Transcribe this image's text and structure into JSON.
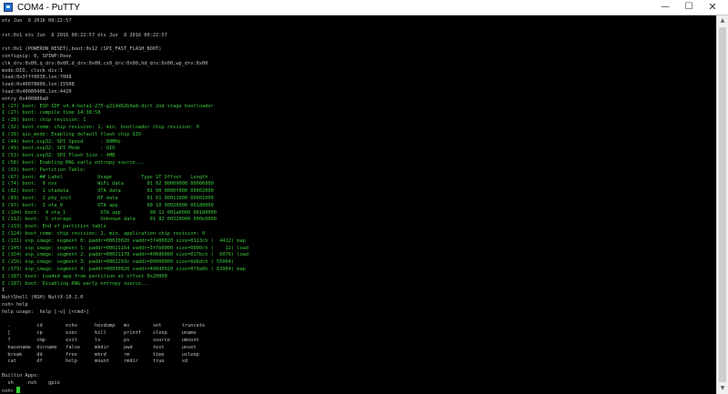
{
  "window": {
    "title": "COM4 - PuTTY",
    "icon": "putty-icon",
    "minimize": "—",
    "maximize": "☐",
    "close": "✕"
  },
  "terminal": {
    "lines": [
      {
        "text": "ets Jun  8 2016 00:22:57",
        "color": "white"
      },
      {
        "text": "",
        "color": "white"
      },
      {
        "text": "rst:0x1 ets Jun  8 2016 00:22:57 ets Jun  8 2016 00:22:57",
        "color": "white"
      },
      {
        "text": "",
        "color": "white"
      },
      {
        "text": "rst:0x1 (POWERON_RESET),boot:0x12 (SPI_FAST_FLASH_BOOT)",
        "color": "white"
      },
      {
        "text": "configsip: 0, SPIWP:0xee",
        "color": "white"
      },
      {
        "text": "clk_drv:0x00,q_drv:0x00,d_drv:0x00,cs0_drv:0x00,hd_drv:0x00,wp_drv:0x00",
        "color": "white"
      },
      {
        "text": "mode:DIO, clock div:1",
        "color": "white"
      },
      {
        "text": "load:0x3fff0030,len:7008",
        "color": "white"
      },
      {
        "text": "load:0x40078000,len:15508",
        "color": "white"
      },
      {
        "text": "load:0x40080400,len:4420",
        "color": "white"
      },
      {
        "text": "entry 0x400806a0",
        "color": "white"
      },
      {
        "text": "I (27) boot: ESP-IDF v4.4-beta1-275-g214d62b9a8-dirt 2nd stage bootloader",
        "color": "green"
      },
      {
        "text": "I (27) boot: compile time 14:38:58",
        "color": "green"
      },
      {
        "text": "I (28) boot: chip revision: 1",
        "color": "green"
      },
      {
        "text": "I (32) boot_comm: chip revision: 1, min. bootloader chip revision: 0",
        "color": "green"
      },
      {
        "text": "I (39) qio_mode: Enabling default flash chip QIO",
        "color": "green"
      },
      {
        "text": "I (44) boot.esp32: SPI Speed      : 80MHz",
        "color": "green"
      },
      {
        "text": "I (49) boot.esp32: SPI Mode       : QIO",
        "color": "green"
      },
      {
        "text": "I (53) boot.esp32: SPI Flash Size : 4MB",
        "color": "green"
      },
      {
        "text": "I (58) boot: Enabling RNG early entropy source...",
        "color": "green"
      },
      {
        "text": "I (63) boot: Partition Table:",
        "color": "green"
      },
      {
        "text": "I (67) boot: ## Label            Usage          Type ST Offset   Length",
        "color": "green"
      },
      {
        "text": "I (74) boot:  0 nvs              WiFi data        01 02 00009000 00006000",
        "color": "green"
      },
      {
        "text": "I (82) boot:  1 otadata          OTA data         01 00 0000f000 00002000",
        "color": "green"
      },
      {
        "text": "I (89) boot:  2 phy_init         RF data          01 01 00011000 00001000",
        "color": "green"
      },
      {
        "text": "I (97) boot:  3 ota_0            OTA app          00 10 00020000 00180000",
        "color": "green"
      },
      {
        "text": "I (104) boot:  4 ota_1            OTA app          00 11 001a0000 00180000",
        "color": "green"
      },
      {
        "text": "I (112) boot:  5 storage          Unknown data     01 82 00320000 000e0000",
        "color": "green"
      },
      {
        "text": "I (119) boot: End of partition table",
        "color": "green"
      },
      {
        "text": "I (124) boot_comm: chip revision: 1, min. application chip revision: 0",
        "color": "green"
      },
      {
        "text": "I (131) esp_image: segment 0: paddr=00020020 vaddr=3f400020 size=0113ch (  4412) map",
        "color": "green"
      },
      {
        "text": "I (145) esp_image: segment 1: paddr=00021164 vaddr=3ffb0000 size=0000ch (    12) load",
        "color": "green"
      },
      {
        "text": "I (154) esp_image: segment 2: paddr=00021178 vaddr=40080000 size=017bch (  6076) load",
        "color": "green"
      },
      {
        "text": "I (156) esp_image: segment 3: paddr=0002293c vaddr=00000000 size=0d6dch ( 55004)",
        "color": "green"
      },
      {
        "text": "I (179) esp_image: segment 4: paddr=00030020 vaddr=400d0020 size=0f9a0h ( 63904) map",
        "color": "green"
      },
      {
        "text": "I (187) boot: Loaded app from partition at offset 0x20000",
        "color": "green"
      },
      {
        "text": "I (187) boot: Disabling RNG early entropy source...",
        "color": "green"
      },
      {
        "text": "I",
        "color": "white"
      },
      {
        "text": "NuttShell (NSH) NuttX-10.2.0",
        "color": "white"
      },
      {
        "text": "nsh> help",
        "color": "white"
      },
      {
        "text": "help usage:  help [-v] [<cmd>]",
        "color": "white"
      },
      {
        "text": "",
        "color": "white"
      },
      {
        "text": "  .         cd        echo      hexdump   mv        set       truncate",
        "color": "white"
      },
      {
        "text": "  [         cp        exec      kill      printf    sleep     uname",
        "color": "white"
      },
      {
        "text": "  ?         cmp       exit      ls        ps        source    umount",
        "color": "white"
      },
      {
        "text": "  basename  dirname   false     mkdir     pwd       test      unset",
        "color": "white"
      },
      {
        "text": "  break     dd        free      mkrd      rm        time      usleep",
        "color": "white"
      },
      {
        "text": "  cat       df        help      mount     rmdir     true      xd",
        "color": "white"
      },
      {
        "text": "",
        "color": "white"
      },
      {
        "text": "Builtin Apps:",
        "color": "white"
      },
      {
        "text": "  sh     nsh    gpio",
        "color": "white"
      },
      {
        "text": "nsh> ",
        "color": "white",
        "cursor": true
      }
    ]
  },
  "scrollbar": {
    "up_arrow": "▲",
    "down_arrow": "▼"
  }
}
